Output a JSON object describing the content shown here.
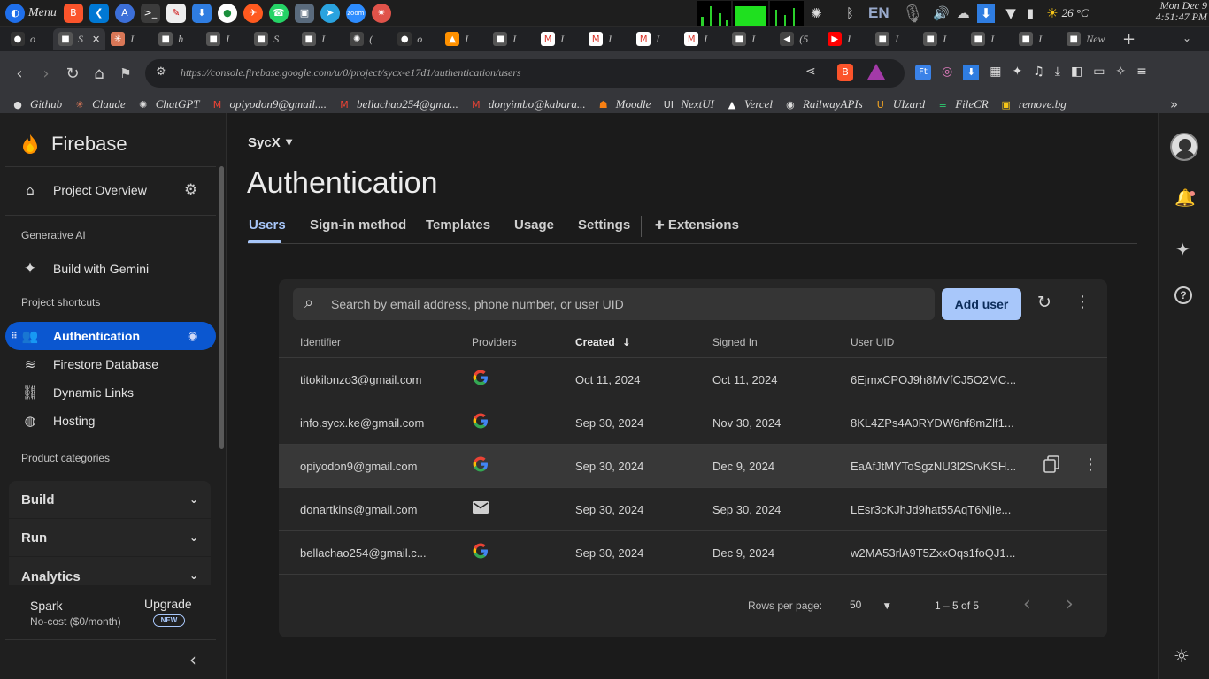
{
  "taskbar": {
    "menu_label": "Menu",
    "language": "EN",
    "temperature": "26 °C",
    "date": "Mon Dec 9",
    "time": "4:51:47 PM"
  },
  "browser": {
    "tabs": [
      {
        "label": "o",
        "icon": "github-icon"
      },
      {
        "label": "S",
        "icon": "app-icon",
        "active": true
      },
      {
        "label": "I",
        "icon": "claude-icon"
      },
      {
        "label": "h",
        "icon": "app-icon"
      },
      {
        "label": "I",
        "icon": "app-icon"
      },
      {
        "label": "S",
        "icon": "app-icon"
      },
      {
        "label": "I",
        "icon": "app-icon"
      },
      {
        "label": "(",
        "icon": "chatgpt-icon"
      },
      {
        "label": "o",
        "icon": "github-icon"
      },
      {
        "label": "I",
        "icon": "firebase-icon"
      },
      {
        "label": "I",
        "icon": "app-icon"
      },
      {
        "label": "I",
        "icon": "gmail-icon"
      },
      {
        "label": "I",
        "icon": "gmail-icon"
      },
      {
        "label": "I",
        "icon": "gmail-icon"
      },
      {
        "label": "I",
        "icon": "gmail-icon"
      },
      {
        "label": "I",
        "icon": "app-icon"
      },
      {
        "label": "(5",
        "icon": "audio-icon"
      },
      {
        "label": "I",
        "icon": "youtube-icon"
      },
      {
        "label": "I",
        "icon": "app-icon"
      },
      {
        "label": "I",
        "icon": "app-icon"
      },
      {
        "label": "I",
        "icon": "app-icon"
      },
      {
        "label": "I",
        "icon": "app-icon"
      },
      {
        "label": "New",
        "icon": "app-icon"
      }
    ],
    "url": "https://console.firebase.google.com/u/0/project/sycx-e17d1/authentication/users",
    "bookmarks": [
      {
        "label": "Github",
        "icon": "github-icon"
      },
      {
        "label": "Claude",
        "icon": "claude-icon"
      },
      {
        "label": "ChatGPT",
        "icon": "chatgpt-icon"
      },
      {
        "label": "opiyodon9@gmail....",
        "icon": "gmail-icon"
      },
      {
        "label": "bellachao254@gma...",
        "icon": "gmail-icon"
      },
      {
        "label": "donyimbo@kabara...",
        "icon": "gmail-icon"
      },
      {
        "label": "Moodle",
        "icon": "moodle-icon"
      },
      {
        "label": "NextUI",
        "icon": "nextui-icon"
      },
      {
        "label": "Vercel",
        "icon": "vercel-icon"
      },
      {
        "label": "RailwayAPIs",
        "icon": "railway-icon"
      },
      {
        "label": "UIzard",
        "icon": "uizard-icon"
      },
      {
        "label": "FileCR",
        "icon": "filecr-icon"
      },
      {
        "label": "remove.bg",
        "icon": "removebg-icon"
      }
    ]
  },
  "sidebar": {
    "brand": "Firebase",
    "project_overview": "Project Overview",
    "section_genai": "Generative AI",
    "build_with_gemini": "Build with Gemini",
    "section_shortcuts": "Project shortcuts",
    "shortcuts": [
      "Authentication",
      "Firestore Database",
      "Dynamic Links",
      "Hosting"
    ],
    "section_categories": "Product categories",
    "categories": [
      "Build",
      "Run",
      "Analytics"
    ],
    "plan_name": "Spark",
    "plan_desc": "No-cost ($0/month)",
    "upgrade": "Upgrade",
    "new_badge": "NEW"
  },
  "main": {
    "project_name": "SycX",
    "page_title": "Authentication",
    "tabs": [
      "Users",
      "Sign-in method",
      "Templates",
      "Usage",
      "Settings",
      "Extensions"
    ],
    "search_placeholder": "Search by email address, phone number, or user UID",
    "add_user": "Add user",
    "columns": [
      "Identifier",
      "Providers",
      "Created",
      "Signed In",
      "User UID"
    ],
    "users": [
      {
        "identifier": "titokilonzo3@gmail.com",
        "provider": "google",
        "created": "Oct 11, 2024",
        "signed_in": "Oct 11, 2024",
        "uid": "6EjmxCPOJ9h8MVfCJ5O2MC..."
      },
      {
        "identifier": "info.sycx.ke@gmail.com",
        "provider": "google",
        "created": "Sep 30, 2024",
        "signed_in": "Nov 30, 2024",
        "uid": "8KL4ZPs4A0RYDW6nf8mZlf1..."
      },
      {
        "identifier": "opiyodon9@gmail.com",
        "provider": "google",
        "created": "Sep 30, 2024",
        "signed_in": "Dec 9, 2024",
        "uid": "EaAfJtMYToSgzNU3l2SrvKSH..."
      },
      {
        "identifier": "donartkins@gmail.com",
        "provider": "email",
        "created": "Sep 30, 2024",
        "signed_in": "Sep 30, 2024",
        "uid": "LEsr3cKJhJd9hat55AqT6NjIe..."
      },
      {
        "identifier": "bellachao254@gmail.c...",
        "provider": "google",
        "created": "Sep 30, 2024",
        "signed_in": "Dec 9, 2024",
        "uid": "w2MA53rlA9T5ZxxOqs1foQJ1..."
      }
    ],
    "rows_per_page_label": "Rows per page:",
    "rows_per_page": "50",
    "range": "1 – 5 of 5"
  },
  "colors": {
    "accent": "#0b57d0",
    "add_user_bg": "#a8c7fa",
    "firebase_orange": "#ff9100"
  }
}
